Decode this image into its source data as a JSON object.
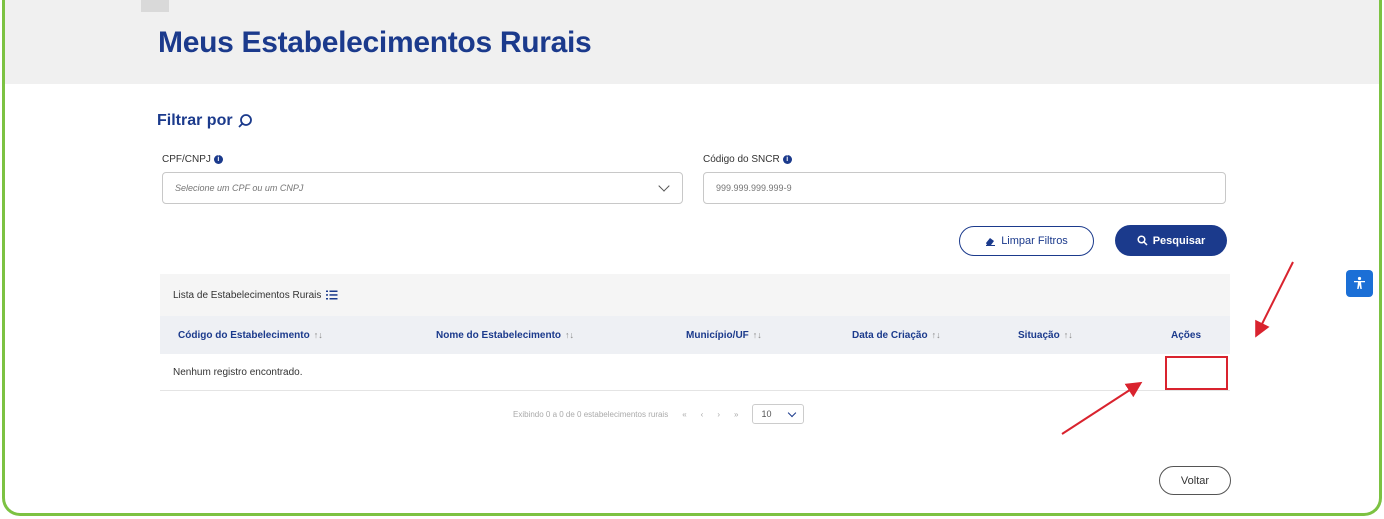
{
  "page": {
    "title": "Meus Estabelecimentos Rurais"
  },
  "filter": {
    "heading": "Filtrar por",
    "cpf_label": "CPF/CNPJ",
    "cpf_placeholder": "Selecione um CPF ou um CNPJ",
    "sncr_label": "Código do SNCR",
    "sncr_placeholder": "999.999.999.999-9",
    "clear_label": "Limpar Filtros",
    "search_label": "Pesquisar"
  },
  "table": {
    "caption": "Lista de Estabelecimentos Rurais",
    "columns": [
      "Código do Estabelecimento",
      "Nome do Estabelecimento",
      "Município/UF",
      "Data de Criação",
      "Situação",
      "Ações"
    ],
    "empty_message": "Nenhum registro encontrado."
  },
  "pagination": {
    "summary": "Exibindo 0 a 0 de 0 estabelecimentos rurais",
    "first": "«",
    "prev": "‹",
    "next": "›",
    "last": "»",
    "page_size": "10"
  },
  "footer": {
    "back_label": "Voltar"
  },
  "icons": {
    "search": "search-icon",
    "info": "info-icon",
    "eraser": "eraser-icon",
    "list": "list-icon",
    "sort": "sort-icon",
    "accessibility": "accessibility-icon"
  },
  "colors": {
    "brand": "#1b3a8c",
    "frame": "#7cc242",
    "annotation": "#d9232e",
    "float_button": "#1b6fd6"
  }
}
